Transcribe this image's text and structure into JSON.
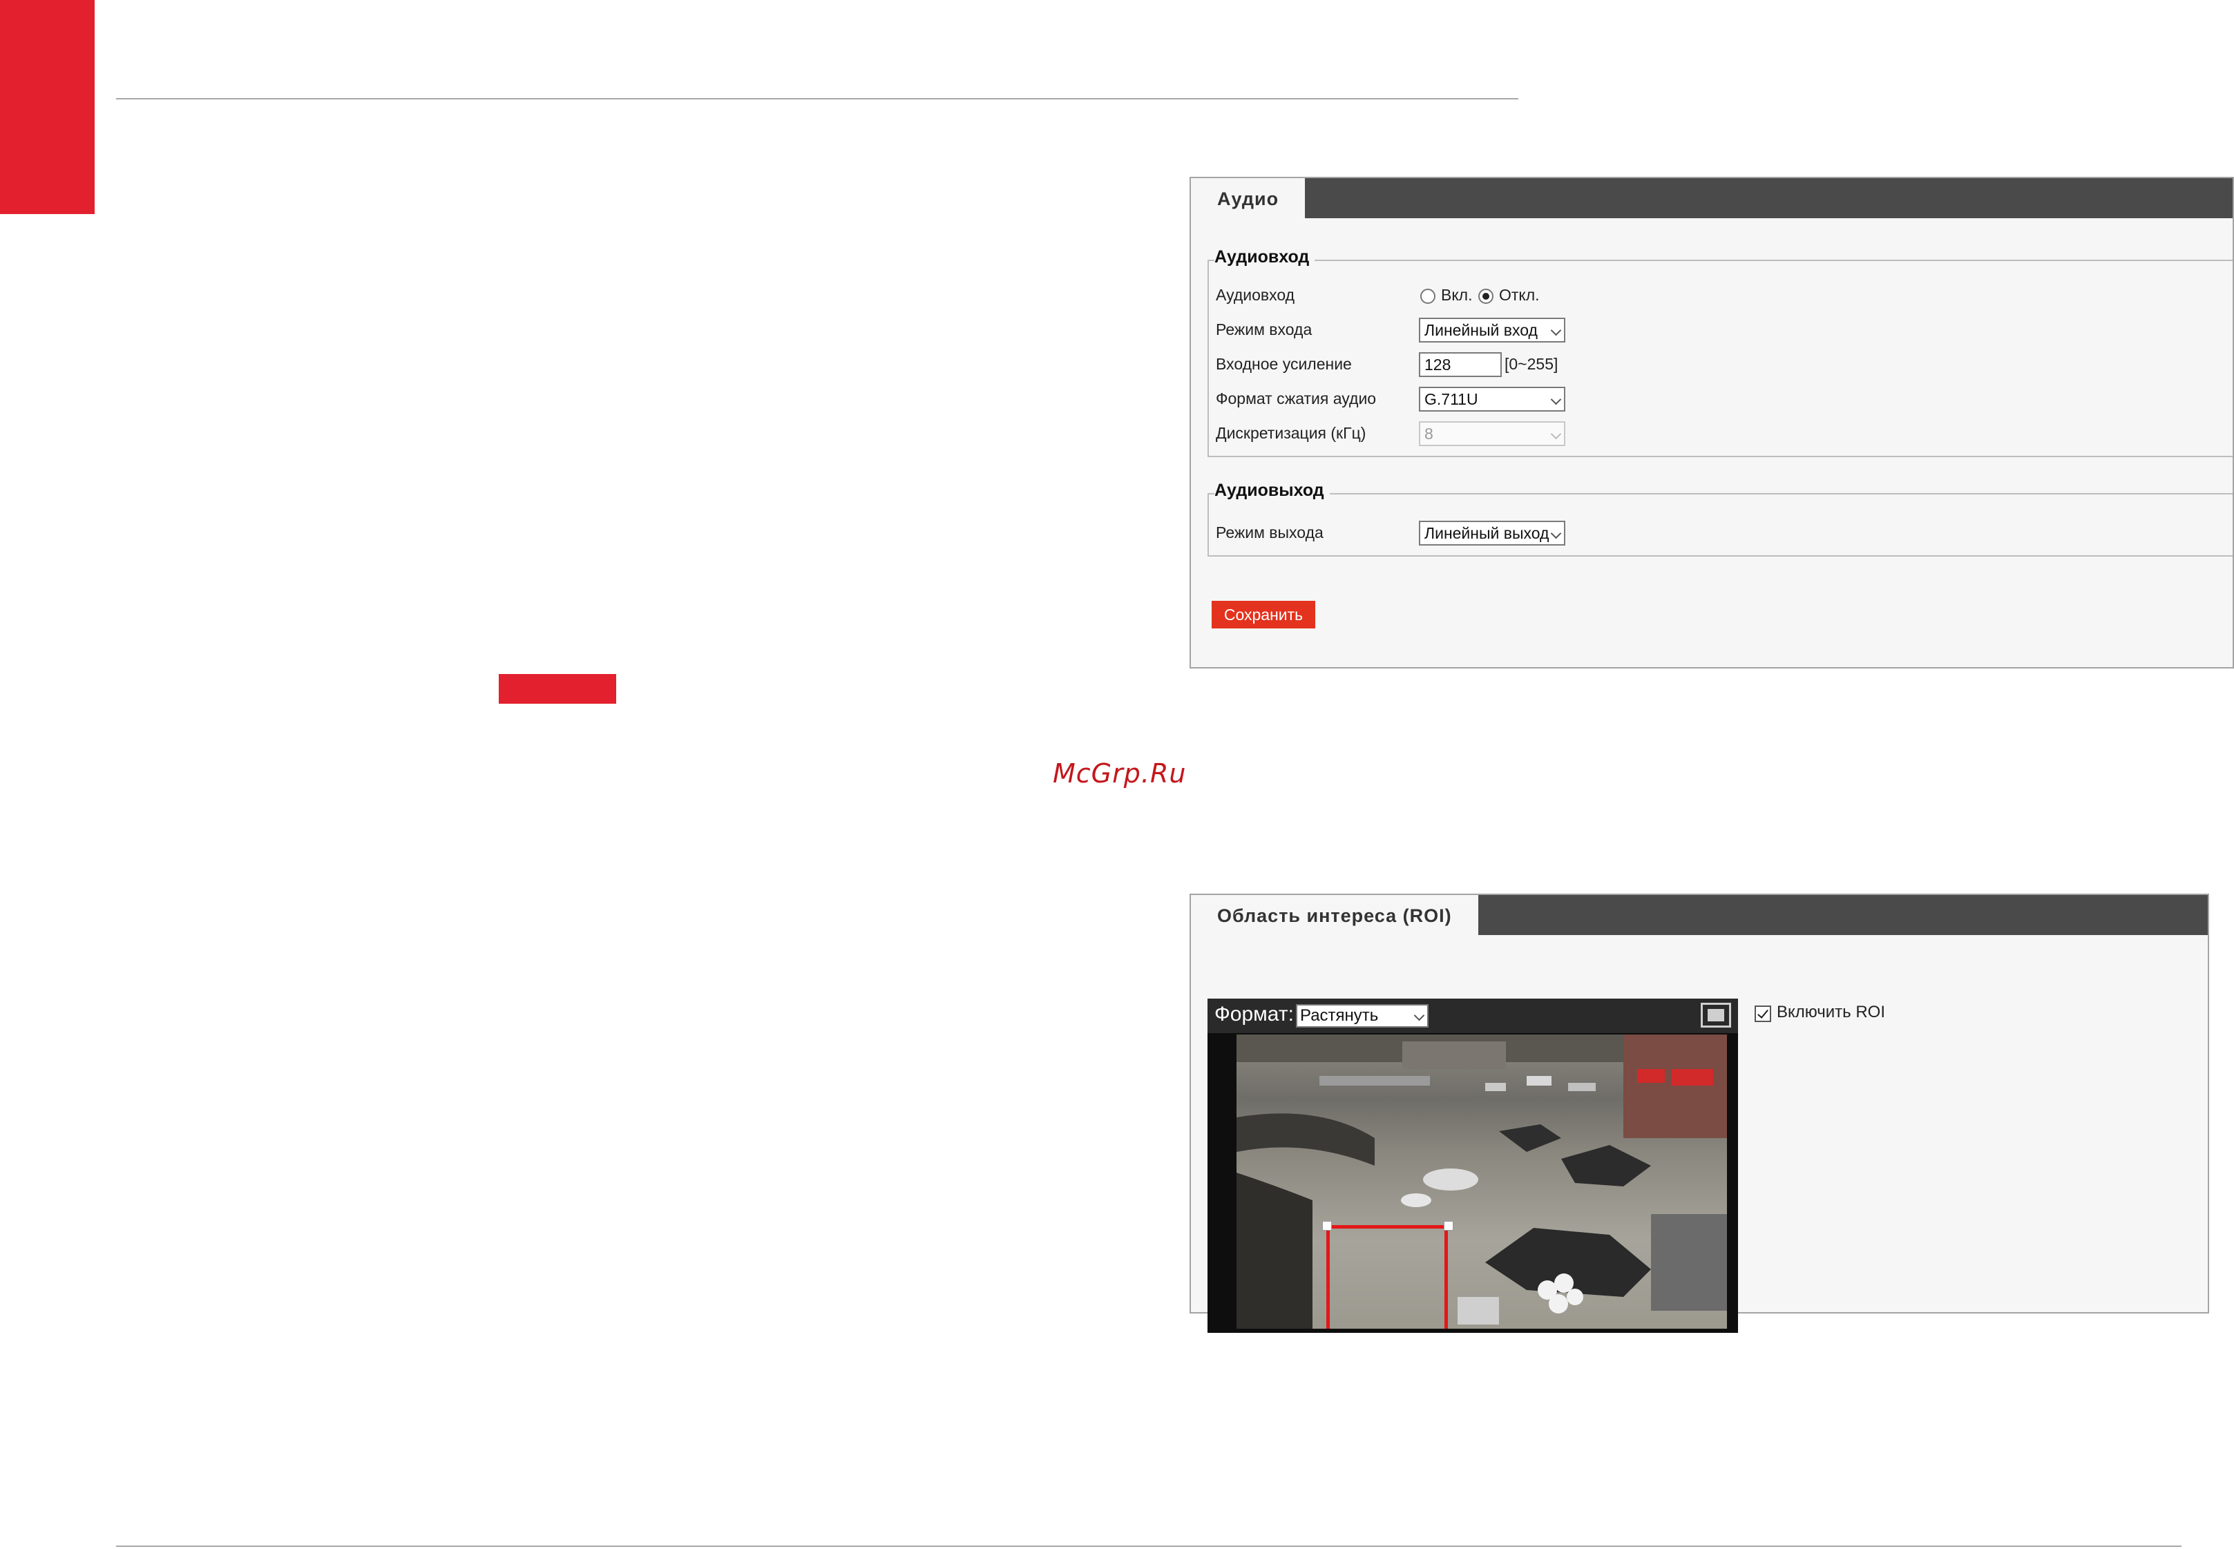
{
  "watermark": "McGrp.Ru",
  "audio": {
    "tab": "Аудио",
    "input_group": {
      "legend": "Аудиовход",
      "audio_input_label": "Аудиовход",
      "on_label": "Вкл.",
      "off_label": "Откл.",
      "selected": "Откл.",
      "input_mode_label": "Режим входа",
      "input_mode_value": "Линейный вход",
      "gain_label": "Входное усиление",
      "gain_value": "128",
      "gain_range": "[0~255]",
      "codec_label": "Формат сжатия аудио",
      "codec_value": "G.711U",
      "sampling_label": "Дискретизация (кГц)",
      "sampling_value": "8"
    },
    "output_group": {
      "legend": "Аудиовыход",
      "output_mode_label": "Режим выхода",
      "output_mode_value": "Линейный выход"
    },
    "save_label": "Сохранить"
  },
  "roi": {
    "tab": "Область интереса (ROI)",
    "format_label": "Формат:",
    "format_value": "Растянуть",
    "enable_label": "Включить ROI",
    "enabled": true
  },
  "colors": {
    "brand_red": "#e3202e",
    "tab_bar": "#4a4a4a",
    "save_button": "#e3321e",
    "roi_frame": "#e21818"
  }
}
